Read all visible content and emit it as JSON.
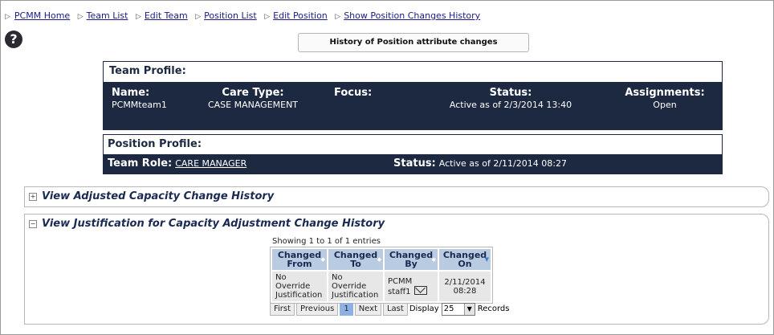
{
  "breadcrumb": [
    {
      "label": "PCMM Home"
    },
    {
      "label": "Team List"
    },
    {
      "label": "Edit Team"
    },
    {
      "label": "Position List"
    },
    {
      "label": "Edit Position"
    },
    {
      "label": "Show Position Changes History"
    }
  ],
  "help_label": "?",
  "history_button": "History of Position attribute changes",
  "team_profile": {
    "title": "Team Profile:",
    "name_label": "Name:",
    "name_value": "PCMMteam1",
    "care_type_label": "Care Type:",
    "care_type_value": "CASE MANAGEMENT",
    "focus_label": "Focus:",
    "status_label": "Status:",
    "status_value": "Active as of 2/3/2014 13:40",
    "assignments_label": "Assignments:",
    "assignments_value": "Open"
  },
  "position_profile": {
    "title": "Position Profile:",
    "team_role_label": "Team Role:",
    "team_role_value": "CARE MANAGER",
    "status_label": "Status:",
    "status_value": "Active as of 2/11/2014 08:27"
  },
  "sections": {
    "adjusted": {
      "title": "View Adjusted Capacity Change History",
      "toggle": "+"
    },
    "justification": {
      "title": "View Justification for Capacity Adjustment Change History",
      "toggle": "−"
    }
  },
  "table": {
    "showing": "Showing 1 to 1 of 1 entries",
    "headers": [
      {
        "l1": "Changed",
        "l2": "From"
      },
      {
        "l1": "Changed",
        "l2": "To"
      },
      {
        "l1": "Changed",
        "l2": "By"
      },
      {
        "l1": "Changed",
        "l2": "On"
      }
    ],
    "rows": [
      {
        "from1": "No Override",
        "from2": "Justification",
        "to1": "No Override",
        "to2": "Justification",
        "by1": "PCMM",
        "by2": "staff1",
        "on1": "2/11/2014",
        "on2": "08:28"
      }
    ]
  },
  "pager": {
    "first": "First",
    "previous": "Previous",
    "current": "1",
    "next": "Next",
    "last": "Last",
    "display_label": "Display",
    "display_value": "25",
    "records_label": "Records"
  },
  "colors": {
    "header_bg": "#1d2941",
    "table_header": "#b8cbe0",
    "link": "#1a1a8c"
  }
}
